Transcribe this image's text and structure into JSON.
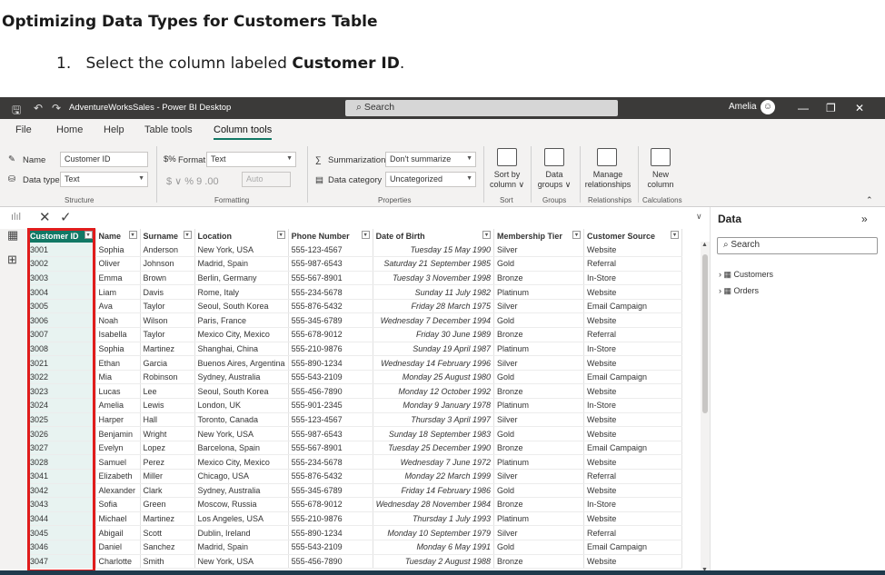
{
  "doc": {
    "title": "Optimizing Data Types for Customers Table",
    "step_num": "1.",
    "step_pre": "Select the column labeled ",
    "step_bold": "Customer ID",
    "step_post": "."
  },
  "titlebar": {
    "app_title": "AdventureWorksSales - Power BI Desktop",
    "search": "Search",
    "user": "Amelia"
  },
  "menu": [
    "File",
    "Home",
    "Help",
    "Table tools",
    "Column tools"
  ],
  "ribbon": {
    "name_label": "Name",
    "name_value": "Customer ID",
    "datatype_label": "Data type",
    "datatype_value": "Text",
    "structure_group": "Structure",
    "format_label": "Format",
    "format_value": "Text",
    "currency_symbols": "$ ∨ %  9  .00",
    "auto": "Auto",
    "formatting_group": "Formatting",
    "summarization_label": "Summarization",
    "summarization_value": "Don't summarize",
    "datacategory_label": "Data category",
    "datacategory_value": "Uncategorized",
    "properties_group": "Properties",
    "sortby": "Sort by\ncolumn ∨",
    "sort_group": "Sort",
    "datagroups": "Data\ngroups ∨",
    "groups_group": "Groups",
    "managerel": "Manage\nrelationships",
    "relationships_group": "Relationships",
    "newcol": "New\ncolumn",
    "calculations_group": "Calculations"
  },
  "grid": {
    "columns": [
      "Customer ID",
      "Name",
      "Surname",
      "Location",
      "Phone Number",
      "Date of Birth",
      "Membership Tier",
      "Customer Source"
    ],
    "rows": [
      [
        "3001",
        "Sophia",
        "Anderson",
        "New York, USA",
        "555-123-4567",
        "Tuesday 15 May 1990",
        "Silver",
        "Website"
      ],
      [
        "3002",
        "Oliver",
        "Johnson",
        "Madrid, Spain",
        "555-987-6543",
        "Saturday 21 September 1985",
        "Gold",
        "Referral"
      ],
      [
        "3003",
        "Emma",
        "Brown",
        "Berlin, Germany",
        "555-567-8901",
        "Tuesday 3 November 1998",
        "Bronze",
        "In-Store"
      ],
      [
        "3004",
        "Liam",
        "Davis",
        "Rome, Italy",
        "555-234-5678",
        "Sunday 11 July 1982",
        "Platinum",
        "Website"
      ],
      [
        "3005",
        "Ava",
        "Taylor",
        "Seoul, South Korea",
        "555-876-5432",
        "Friday 28 March 1975",
        "Silver",
        "Email Campaign"
      ],
      [
        "3006",
        "Noah",
        "Wilson",
        "Paris, France",
        "555-345-6789",
        "Wednesday 7 December 1994",
        "Gold",
        "Website"
      ],
      [
        "3007",
        "Isabella",
        "Taylor",
        "Mexico City, Mexico",
        "555-678-9012",
        "Friday 30 June 1989",
        "Bronze",
        "Referral"
      ],
      [
        "3008",
        "Sophia",
        "Martinez",
        "Shanghai, China",
        "555-210-9876",
        "Sunday 19 April 1987",
        "Platinum",
        "In-Store"
      ],
      [
        "3021",
        "Ethan",
        "Garcia",
        "Buenos Aires, Argentina",
        "555-890-1234",
        "Wednesday 14 February 1996",
        "Silver",
        "Website"
      ],
      [
        "3022",
        "Mia",
        "Robinson",
        "Sydney, Australia",
        "555-543-2109",
        "Monday 25 August 1980",
        "Gold",
        "Email Campaign"
      ],
      [
        "3023",
        "Lucas",
        "Lee",
        "Seoul, South Korea",
        "555-456-7890",
        "Monday 12 October 1992",
        "Bronze",
        "Website"
      ],
      [
        "3024",
        "Amelia",
        "Lewis",
        "London, UK",
        "555-901-2345",
        "Monday 9 January 1978",
        "Platinum",
        "In-Store"
      ],
      [
        "3025",
        "Harper",
        "Hall",
        "Toronto, Canada",
        "555-123-4567",
        "Thursday 3 April 1997",
        "Silver",
        "Website"
      ],
      [
        "3026",
        "Benjamin",
        "Wright",
        "New York, USA",
        "555-987-6543",
        "Sunday 18 September 1983",
        "Gold",
        "Website"
      ],
      [
        "3027",
        "Evelyn",
        "Lopez",
        "Barcelona, Spain",
        "555-567-8901",
        "Tuesday 25 December 1990",
        "Bronze",
        "Email Campaign"
      ],
      [
        "3028",
        "Samuel",
        "Perez",
        "Mexico City, Mexico",
        "555-234-5678",
        "Wednesday 7 June 1972",
        "Platinum",
        "Website"
      ],
      [
        "3041",
        "Elizabeth",
        "Miller",
        "Chicago, USA",
        "555-876-5432",
        "Monday 22 March 1999",
        "Silver",
        "Referral"
      ],
      [
        "3042",
        "Alexander",
        "Clark",
        "Sydney, Australia",
        "555-345-6789",
        "Friday 14 February 1986",
        "Gold",
        "Website"
      ],
      [
        "3043",
        "Sofia",
        "Green",
        "Moscow, Russia",
        "555-678-9012",
        "Wednesday 28 November 1984",
        "Bronze",
        "In-Store"
      ],
      [
        "3044",
        "Michael",
        "Martinez",
        "Los Angeles, USA",
        "555-210-9876",
        "Thursday 1 July 1993",
        "Platinum",
        "Website"
      ],
      [
        "3045",
        "Abigail",
        "Scott",
        "Dublin, Ireland",
        "555-890-1234",
        "Monday 10 September 1979",
        "Silver",
        "Referral"
      ],
      [
        "3046",
        "Daniel",
        "Sanchez",
        "Madrid, Spain",
        "555-543-2109",
        "Monday 6 May 1991",
        "Gold",
        "Email Campaign"
      ],
      [
        "3047",
        "Charlotte",
        "Smith",
        "New York, USA",
        "555-456-7890",
        "Tuesday 2 August 1988",
        "Bronze",
        "Website"
      ]
    ]
  },
  "datapane": {
    "title": "Data",
    "search": "Search",
    "tables": [
      "Customers",
      "Orders"
    ]
  },
  "colors": {
    "accent": "#117865",
    "highlight": "#e01c1c",
    "titlebar": "#3b3a39"
  }
}
